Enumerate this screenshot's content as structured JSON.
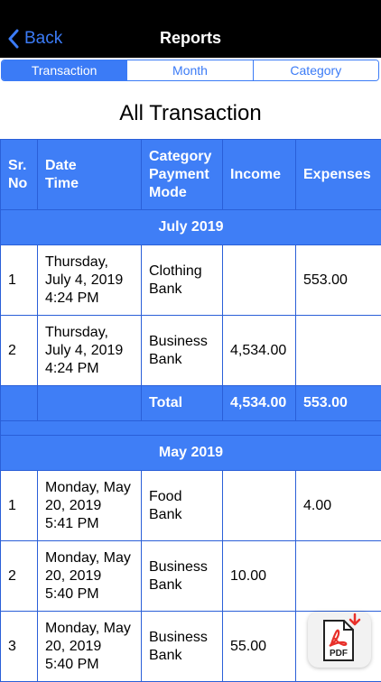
{
  "nav": {
    "back_label": "Back",
    "title": "Reports"
  },
  "tabs": [
    {
      "label": "Transaction",
      "active": true
    },
    {
      "label": "Month",
      "active": false
    },
    {
      "label": "Category",
      "active": false
    }
  ],
  "heading": "All Transaction",
  "table": {
    "headers": {
      "srno": [
        "Sr.",
        "No"
      ],
      "datetime": [
        "Date",
        "Time"
      ],
      "category": [
        "Category",
        "Payment",
        "Mode"
      ],
      "income": "Income",
      "expenses": "Expenses"
    },
    "groups": [
      {
        "month": "July 2019",
        "rows": [
          {
            "sr": "1",
            "date": [
              "Thursday,",
              "July 4, 2019",
              "4:24 PM"
            ],
            "category": [
              "Clothing",
              "Bank"
            ],
            "income": "",
            "expenses": "553.00"
          },
          {
            "sr": "2",
            "date": [
              "Thursday,",
              "July 4, 2019",
              "4:24 PM"
            ],
            "category": [
              "Business",
              "Bank"
            ],
            "income": "4,534.00",
            "expenses": ""
          }
        ],
        "total": {
          "label": "Total",
          "income": "4,534.00",
          "expenses": "553.00"
        }
      },
      {
        "month": "May 2019",
        "rows": [
          {
            "sr": "1",
            "date": [
              "Monday, May",
              "20, 2019",
              "5:41 PM"
            ],
            "category": [
              "Food",
              "Bank"
            ],
            "income": "",
            "expenses": "4.00"
          },
          {
            "sr": "2",
            "date": [
              "Monday, May",
              "20, 2019",
              "5:40 PM"
            ],
            "category": [
              "Business",
              "Bank"
            ],
            "income": "10.00",
            "expenses": ""
          },
          {
            "sr": "3",
            "date": [
              "Monday, May",
              "20, 2019",
              "5:40 PM"
            ],
            "category": [
              "Business",
              "Bank"
            ],
            "income": "55.00",
            "expenses": ""
          }
        ]
      }
    ]
  },
  "pdf_button": {
    "label": "PDF",
    "icon": "pdf-download-icon"
  },
  "colors": {
    "accent": "#3b7bf6",
    "header_fill": "#3f7ef6",
    "grid": "#2a5fd8",
    "navbar": "#000000",
    "pdf_red": "#e8302a"
  }
}
